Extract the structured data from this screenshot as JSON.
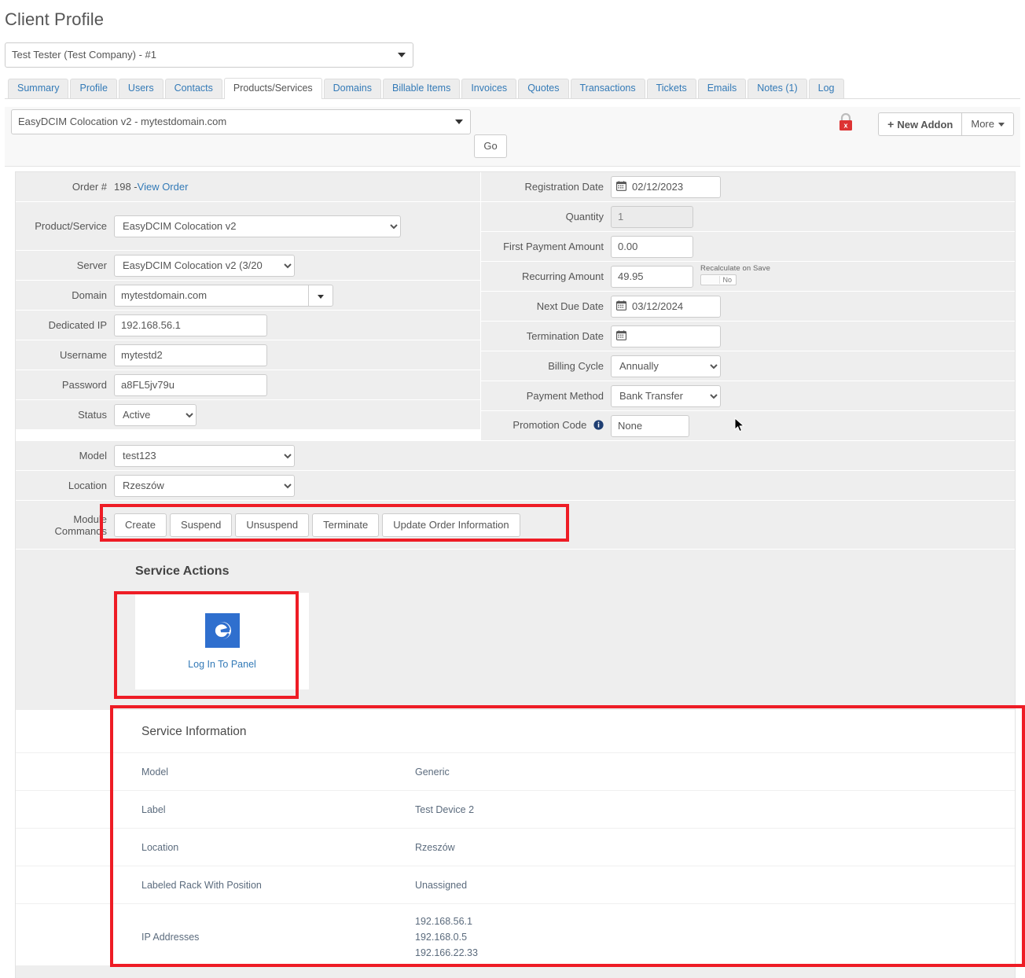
{
  "page": {
    "title": "Client Profile",
    "accent_blue": "#337ab7",
    "highlight_red": "#ee1c25",
    "row_gray": "#eeeeee"
  },
  "client_selector": {
    "value": "Test Tester (Test Company) - #1",
    "icon": "chevron-down-icon"
  },
  "tabs": [
    {
      "label": "Summary",
      "active": false
    },
    {
      "label": "Profile",
      "active": false
    },
    {
      "label": "Users",
      "active": false
    },
    {
      "label": "Contacts",
      "active": false
    },
    {
      "label": "Products/Services",
      "active": true
    },
    {
      "label": "Domains",
      "active": false
    },
    {
      "label": "Billable Items",
      "active": false
    },
    {
      "label": "Invoices",
      "active": false
    },
    {
      "label": "Quotes",
      "active": false
    },
    {
      "label": "Transactions",
      "active": false
    },
    {
      "label": "Tickets",
      "active": false
    },
    {
      "label": "Emails",
      "active": false
    },
    {
      "label": "Notes (1)",
      "active": false
    },
    {
      "label": "Log",
      "active": false
    }
  ],
  "service_toolbar": {
    "service_value": "EasyDCIM Colocation v2 - mytestdomain.com",
    "go_label": "Go",
    "lock_icon": "locked-red-icon",
    "new_addon_label": "New Addon",
    "new_addon_icon": "plus-icon",
    "more_label": "More",
    "more_icon": "caret-down-icon"
  },
  "form": {
    "left": {
      "order_label": "Order #",
      "order_number": "198 - ",
      "order_link": "View Order",
      "product_label": "Product/Service",
      "product_value": "EasyDCIM Colocation v2",
      "server_label": "Server",
      "server_value": "EasyDCIM Colocation v2 (3/20",
      "domain_label": "Domain",
      "domain_value": "mytestdomain.com",
      "dedicated_ip_label": "Dedicated IP",
      "dedicated_ip_value": "192.168.56.1",
      "username_label": "Username",
      "username_value": "mytestd2",
      "password_label": "Password",
      "password_value": "a8FL5jv79u",
      "status_label": "Status",
      "status_value": "Active",
      "model_label": "Model",
      "model_value": "test123",
      "location_label": "Location",
      "location_value": "Rzeszów"
    },
    "right": {
      "registration_date_label": "Registration Date",
      "registration_date_value": "02/12/2023",
      "quantity_label": "Quantity",
      "quantity_value": "1",
      "first_payment_label": "First Payment Amount",
      "first_payment_value": "0.00",
      "recurring_label": "Recurring Amount",
      "recurring_value": "49.95",
      "recalculate_label": "Recalculate on Save",
      "recalculate_value": "No",
      "next_due_label": "Next Due Date",
      "next_due_value": "03/12/2024",
      "termination_label": "Termination Date",
      "termination_value": "",
      "billing_cycle_label": "Billing Cycle",
      "billing_cycle_value": "Annually",
      "payment_method_label": "Payment Method",
      "payment_method_value": "Bank Transfer",
      "promotion_code_label": "Promotion Code",
      "promotion_code_info_icon": "info-circle-icon",
      "promotion_code_value": "None"
    },
    "module_commands": {
      "label_line1": "Module",
      "label_line2": "Commands",
      "buttons": [
        "Create",
        "Suspend",
        "Unsuspend",
        "Terminate",
        "Update Order Information"
      ]
    }
  },
  "service_actions": {
    "title": "Service Actions",
    "card": {
      "icon": "easydcim-logo-icon",
      "label": "Log In To Panel"
    }
  },
  "service_information": {
    "title": "Service Information",
    "rows": [
      {
        "key": "Model",
        "value": "Generic"
      },
      {
        "key": "Label",
        "value": "Test Device 2"
      },
      {
        "key": "Location",
        "value": "Rzeszów"
      },
      {
        "key": "Labeled Rack With Position",
        "value": "Unassigned"
      }
    ],
    "ip_row": {
      "key": "IP Addresses",
      "values": [
        "192.168.56.1",
        "192.168.0.5",
        "192.166.22.33"
      ]
    }
  }
}
